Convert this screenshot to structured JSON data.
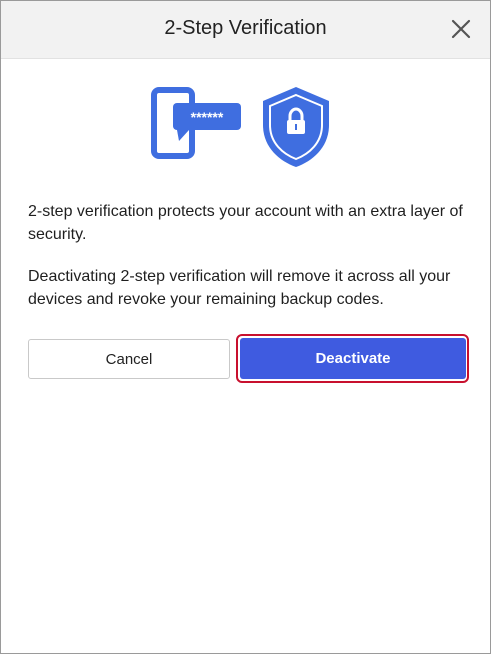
{
  "dialog": {
    "title": "2-Step Verification",
    "close_icon": "close-icon"
  },
  "illustration": {
    "phone_icon": "phone-password-icon",
    "password_mask": "******",
    "shield_icon": "shield-lock-icon",
    "accent_color": "#3f6ee0"
  },
  "body": {
    "paragraph_1": "2-step verification protects your account with an extra layer of security.",
    "paragraph_2": "Deactivating 2-step verification will remove it across all your devices and revoke your remaining backup codes."
  },
  "actions": {
    "cancel_label": "Cancel",
    "deactivate_label": "Deactivate",
    "primary_color": "#3f5be0",
    "highlight_color": "#c8102e"
  }
}
